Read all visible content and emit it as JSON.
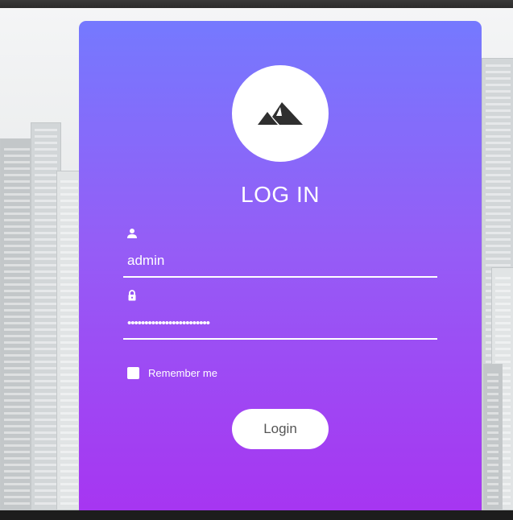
{
  "login": {
    "title": "LOG IN",
    "username_value": "admin",
    "password_value": "••••••••••••••••••••••••",
    "remember_label": "Remember me",
    "remember_checked": false,
    "login_button": "Login"
  },
  "icons": {
    "logo": "mountain-icon",
    "username": "user-icon",
    "password": "lock-icon"
  },
  "colors": {
    "gradient_top": "#7579fe",
    "gradient_bottom": "#a734f1",
    "text": "#ffffff",
    "button_text": "#555555"
  }
}
